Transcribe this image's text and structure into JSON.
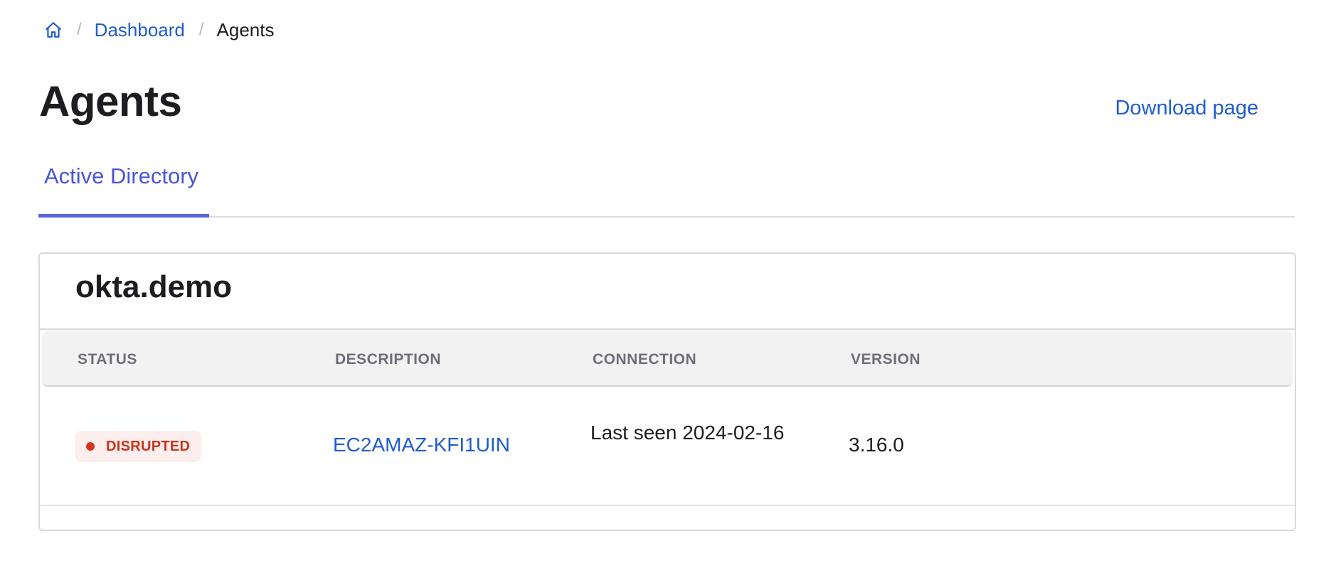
{
  "breadcrumb": {
    "home_icon": "home-icon",
    "items": [
      "Dashboard",
      "Agents"
    ],
    "separator": "/"
  },
  "header": {
    "title": "Agents",
    "download_label": "Download page"
  },
  "tabs": [
    {
      "label": "Active Directory",
      "active": true
    }
  ],
  "card": {
    "title": "okta.demo",
    "columns": [
      "STATUS",
      "DESCRIPTION",
      "CONNECTION",
      "VERSION"
    ],
    "rows": [
      {
        "status": "DISRUPTED",
        "description": "EC2AMAZ-KFI1UIN",
        "connection": "Last seen 2024-02-16",
        "version": "3.16.0"
      }
    ]
  },
  "colors": {
    "link": "#1f5ccf",
    "tab_active": "#5b63dd",
    "status_disrupted": "#c9351f",
    "status_disrupted_bg": "#fbeeec"
  }
}
